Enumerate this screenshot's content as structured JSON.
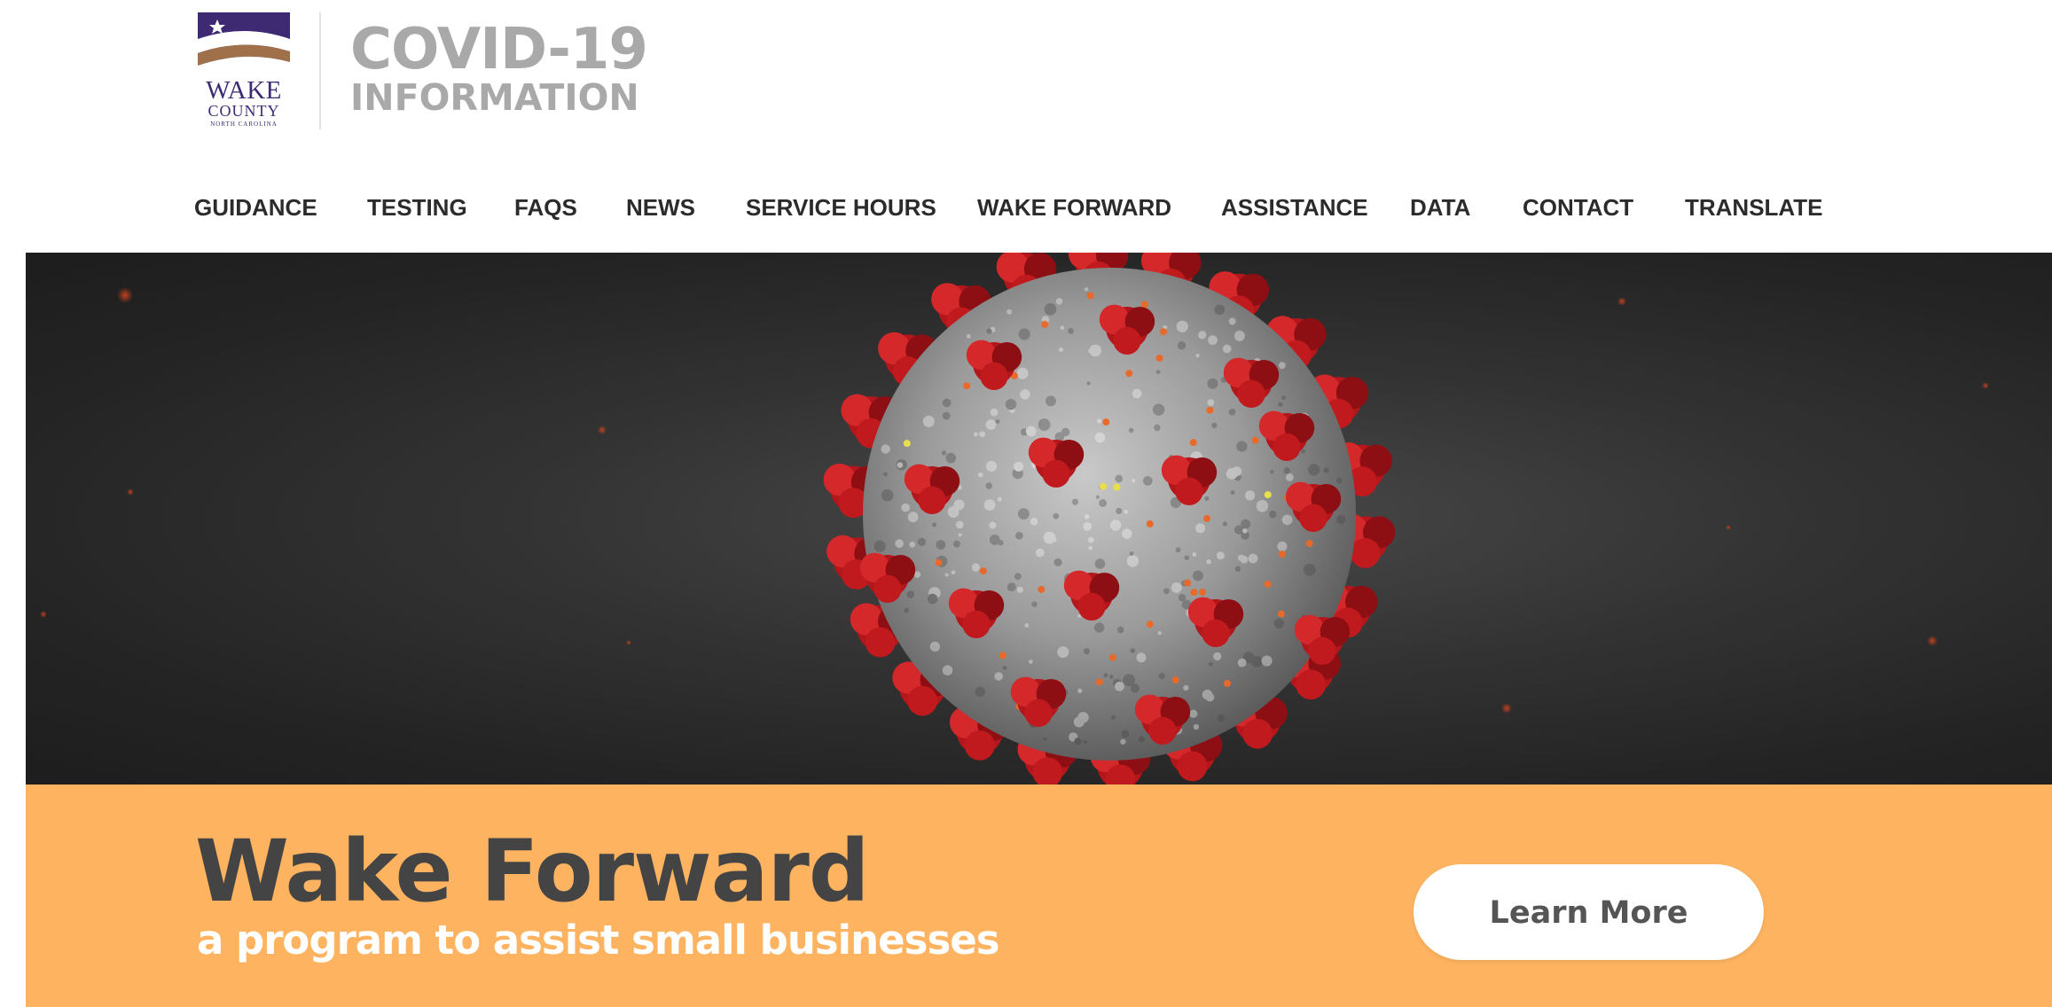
{
  "header": {
    "seal": {
      "line1": "WAKE",
      "line2": "COUNTY",
      "line3": "NORTH CAROLINA"
    },
    "title_line1": "COVID-19",
    "title_line2": "INFORMATION"
  },
  "nav": {
    "items": [
      {
        "label": "GUIDANCE"
      },
      {
        "label": "TESTING"
      },
      {
        "label": "FAQS"
      },
      {
        "label": "NEWS"
      },
      {
        "label": "SERVICE HOURS"
      },
      {
        "label": "WAKE FORWARD"
      },
      {
        "label": "ASSISTANCE"
      },
      {
        "label": "DATA"
      },
      {
        "label": "CONTACT"
      },
      {
        "label": "TRANSLATE"
      }
    ]
  },
  "hero": {
    "image_subject": "coronavirus-illustration"
  },
  "banner": {
    "title": "Wake Forward",
    "subtitle": "a program to assist small businesses",
    "button_label": "Learn More"
  },
  "colors": {
    "banner_bg": "#fdb35f",
    "banner_title": "#444444",
    "nav_text": "#2b2b2b",
    "logo_title": "#a9a9a9",
    "seal_purple": "#3d2a73",
    "seal_brown": "#a0704a",
    "spike_red": "#b3161b",
    "hero_bg": "#2a2a2a"
  }
}
